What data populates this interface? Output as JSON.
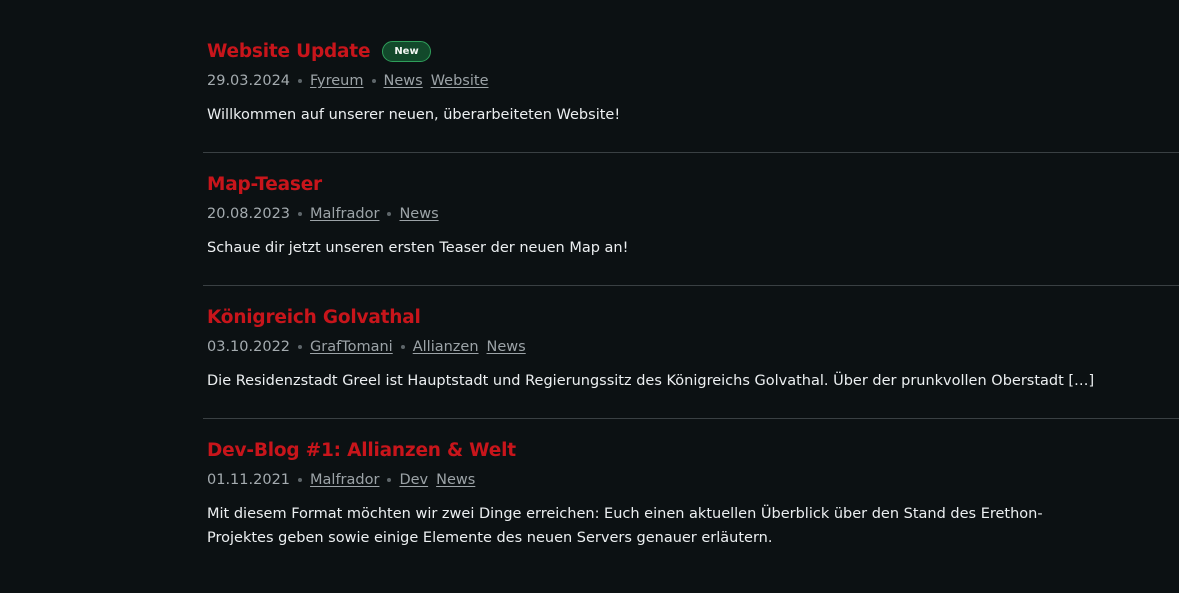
{
  "posts": [
    {
      "title": "Website Update",
      "badge": "New",
      "date": "29.03.2024",
      "author": "Fyreum",
      "tags": [
        "News",
        "Website"
      ],
      "excerpt": "Willkommen auf unserer neuen, überarbeiteten Website!"
    },
    {
      "title": "Map-Teaser",
      "date": "20.08.2023",
      "author": "Malfrador",
      "tags": [
        "News"
      ],
      "excerpt": "Schaue dir jetzt unseren ersten Teaser der neuen Map an!"
    },
    {
      "title": "Königreich Golvathal",
      "date": "03.10.2022",
      "author": "GrafTomani",
      "tags": [
        "Allianzen",
        "News"
      ],
      "excerpt": "Die Residenzstadt Greel ist Hauptstadt und Regierungssitz des Königreichs Golvathal. Über der prunkvollen Oberstadt […]"
    },
    {
      "title": "Dev-Blog #1: Allianzen & Welt",
      "date": "01.11.2021",
      "author": "Malfrador",
      "tags": [
        "Dev",
        "News"
      ],
      "excerpt": "Mit diesem Format möchten wir zwei Dinge erreichen: Euch einen aktuellen Überblick über den Stand des Erethon-Projektes geben sowie einige Elemente des neuen Servers genauer erläutern."
    }
  ],
  "colors": {
    "background": "#0c1113",
    "title": "#c8151b",
    "badge_bg": "#12492b",
    "divider": "#3a4043"
  }
}
